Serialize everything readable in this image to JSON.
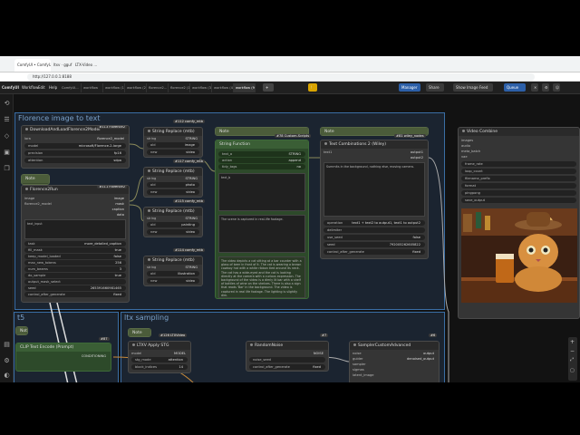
{
  "browser": {
    "tabs": [
      "ComfyUI • ComfyUI",
      "ltxv · gguf",
      "LTX-Video ..."
    ],
    "url": "http://127.0.0.1:8188"
  },
  "menu": {
    "brand": "ComfyUI",
    "items": [
      "Workflow",
      "Edit",
      "Help"
    ],
    "workflow_tabs": [
      "ComfyUI...",
      "workflow",
      "workflow (1)",
      "workflow (2)",
      "florence2...",
      "florence2 (1)",
      "workflow (3)",
      "workflow (4)",
      "workflow (5)",
      "workflow (6)",
      "workflow (7)",
      "workflow (8)"
    ],
    "active_tab": "workflow (9)",
    "queue_label": "Queue",
    "manager_label": "Manager",
    "share_label": "Share",
    "feed_label": "Show Image Feed"
  },
  "groups": {
    "florence": "Florence image to text",
    "sampling": "ltx sampling",
    "left_fragment": "t5"
  },
  "nodes": {
    "download_florence": {
      "title": "DownloadAndLoadFlorence2Model",
      "badge": "#113 Florence2",
      "rows": [
        {
          "k": "lora",
          "v": "florence2_model"
        },
        {
          "k": "model",
          "v": "microsoft/Florence-2-large"
        },
        {
          "k": "precision",
          "v": "fp16"
        },
        {
          "k": "attention",
          "v": "sdpa"
        }
      ]
    },
    "florence_run": {
      "title": "Florence2Run",
      "badge": "#111 Florence2",
      "inputs": [
        "image",
        "florence2_model"
      ],
      "outputs": [
        "image",
        "mask",
        "caption",
        "data"
      ],
      "widgets": [
        {
          "k": "task",
          "v": "more_detailed_caption"
        },
        {
          "k": "fill_mask",
          "v": "true"
        },
        {
          "k": "keep_model_loaded",
          "v": "false"
        },
        {
          "k": "max_new_tokens",
          "v": "256"
        },
        {
          "k": "num_beams",
          "v": "3"
        },
        {
          "k": "do_sample",
          "v": "true"
        },
        {
          "k": "output_mask_select",
          "v": ""
        },
        {
          "k": "seed",
          "v": "265391660981465"
        },
        {
          "k": "control_after_generate",
          "v": "fixed"
        }
      ],
      "text_label": "text_input"
    },
    "sr1": {
      "title": "String Replace (mtb)",
      "badge": "#112 comfy_mtb",
      "rows": [
        {
          "k": "string",
          "v": "STRING"
        },
        {
          "k": "old",
          "v": "image"
        },
        {
          "k": "new",
          "v": "video"
        }
      ]
    },
    "sr2": {
      "title": "String Replace (mtb)",
      "badge": "#117 comfy_mtb",
      "rows": [
        {
          "k": "string",
          "v": "STRING"
        },
        {
          "k": "old",
          "v": "photo"
        },
        {
          "k": "new",
          "v": "video"
        }
      ]
    },
    "sr3": {
      "title": "String Replace (mtb)",
      "badge": "#115 comfy_mtb",
      "rows": [
        {
          "k": "string",
          "v": "STRING"
        },
        {
          "k": "old",
          "v": "painting"
        },
        {
          "k": "new",
          "v": "video"
        }
      ]
    },
    "sr4": {
      "title": "String Replace (mtb)",
      "badge": "#114 comfy_mtb",
      "rows": [
        {
          "k": "string",
          "v": "STRING"
        },
        {
          "k": "old",
          "v": "illustration"
        },
        {
          "k": "new",
          "v": "video"
        }
      ]
    },
    "note_top": {
      "title": "Note"
    },
    "string_function": {
      "title": "String Function",
      "badge": "#78 Custom-Scripts",
      "rows": [
        {
          "k": "text_a",
          "v": "STRING"
        },
        {
          "k": "action",
          "v": "append"
        },
        {
          "k": "tidy_tags",
          "v": "no"
        }
      ],
      "text_b": "text_b",
      "text_c": "The scene is captured in real-life footage.",
      "body": "The video depicts a cat sitting at a bar counter with a glass of beer in front of it. The cat is wearing a brown cowboy hat with a white ribbon tied around its neck. The cat has a wide-eyed and the cat is looking directly at the camera with a curious expression. The background of the video is a dimly lit bar with a shelf of bottles of wine on the shelves. There is also a sign that reads 'Bar' in the background. The video is captured in real life footage. The lighting is slightly dim."
    },
    "note2": {
      "title": "Note"
    },
    "text_combinations": {
      "title": "Text Combinations 2 (Wiley)",
      "badge": "#81 wiley_nodes",
      "in": "text1",
      "outs": [
        "output1",
        "output2"
      ],
      "text_a": "Summits in the background, nothing else, moving camera.",
      "widgets": [
        {
          "k": "operation",
          "v": "text1 + text2 to output1, text1 to output2"
        },
        {
          "k": "delimiter",
          "v": ""
        },
        {
          "k": "use_seed",
          "v": "false"
        },
        {
          "k": "seed",
          "v": "792005262605822"
        },
        {
          "k": "control_after_generate",
          "v": "fixed"
        }
      ]
    },
    "video_combine": {
      "title": "Video Combine",
      "badge": "#4 VideoHelperSuite",
      "inputs": [
        "images",
        "audio",
        "meta_batch",
        "vae"
      ],
      "widgets": [
        "frame_rate",
        "loop_count",
        "filename_prefix",
        "format",
        "pingpong",
        "save_output"
      ]
    },
    "clip_text": {
      "title": "CLIP Text Encode (Prompt)",
      "badge": "#87",
      "out": "CONDITIONING"
    },
    "ltxv_apply": {
      "title": "LTXV Apply STG",
      "badge": "#126 LTXVideo",
      "rows": [
        {
          "k": "model",
          "v": "MODEL"
        },
        {
          "k": "stg_mode",
          "v": "attention"
        },
        {
          "k": "block_indices",
          "v": "14"
        }
      ]
    },
    "random_noise": {
      "title": "RandomNoise",
      "badge": "#7",
      "out": "NOISE",
      "rows": [
        {
          "k": "noise_seed",
          "v": ""
        },
        {
          "k": "control_after_generate",
          "v": "fixed"
        }
      ]
    },
    "sampler_custom": {
      "title": "SamplerCustomAdvanced",
      "badge": "#6",
      "rows": [
        {
          "k": "noise",
          "v": "output"
        },
        {
          "k": "guider",
          "v": "denoised_output"
        },
        {
          "k": "sampler",
          "v": ""
        },
        {
          "k": "sigmas",
          "v": ""
        },
        {
          "k": "latent_image",
          "v": ""
        }
      ]
    },
    "note_bottom": {
      "title": "Note"
    }
  },
  "colors": {
    "background": "#121212",
    "node": "#353535",
    "accent": "#2c5fa8",
    "note": "#3a4a2e",
    "group": "#3a6ea5"
  }
}
